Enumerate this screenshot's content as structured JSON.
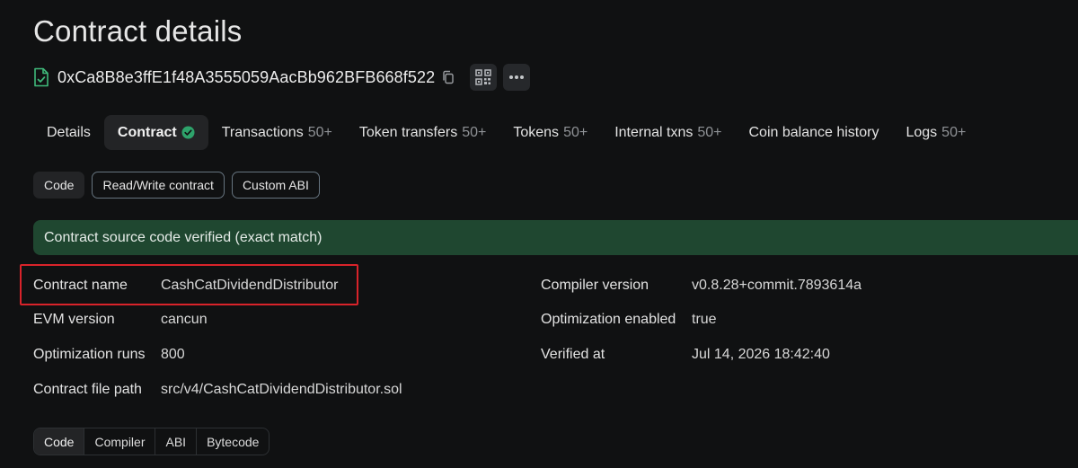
{
  "page": {
    "title": "Contract details"
  },
  "address": {
    "value": "0xCa8B8e3ffE1f48A3555059AacBb962BFB668f522"
  },
  "tabs": [
    {
      "label": "Details",
      "count": ""
    },
    {
      "label": "Contract",
      "count": "",
      "verified": true
    },
    {
      "label": "Transactions",
      "count": "50+"
    },
    {
      "label": "Token transfers",
      "count": "50+"
    },
    {
      "label": "Tokens",
      "count": "50+"
    },
    {
      "label": "Internal txns",
      "count": "50+"
    },
    {
      "label": "Coin balance history",
      "count": ""
    },
    {
      "label": "Logs",
      "count": "50+"
    }
  ],
  "subtabs": [
    {
      "label": "Code",
      "active": true
    },
    {
      "label": "Read/Write contract",
      "active": false
    },
    {
      "label": "Custom ABI",
      "active": false
    }
  ],
  "banner": {
    "text": "Contract source code verified (exact match)"
  },
  "info": {
    "contract_name": {
      "label": "Contract name",
      "value": "CashCatDividendDistributor"
    },
    "evm_version": {
      "label": "EVM version",
      "value": "cancun"
    },
    "optimization_runs": {
      "label": "Optimization runs",
      "value": "800"
    },
    "file_path": {
      "label": "Contract file path",
      "value": "src/v4/CashCatDividendDistributor.sol"
    },
    "compiler_version": {
      "label": "Compiler version",
      "value": "v0.8.28+commit.7893614a"
    },
    "optimization_enabled": {
      "label": "Optimization enabled",
      "value": "true"
    },
    "verified_at": {
      "label": "Verified at",
      "value": "Jul 14, 2026 18:42:40"
    }
  },
  "code_tabs": [
    {
      "label": "Code",
      "active": true
    },
    {
      "label": "Compiler",
      "active": false
    },
    {
      "label": "ABI",
      "active": false
    },
    {
      "label": "Bytecode",
      "active": false
    }
  ],
  "colors": {
    "background": "#101112",
    "verified_green": "#1f4730",
    "check_green": "#2ea36b",
    "highlight_red": "#d8232a"
  }
}
